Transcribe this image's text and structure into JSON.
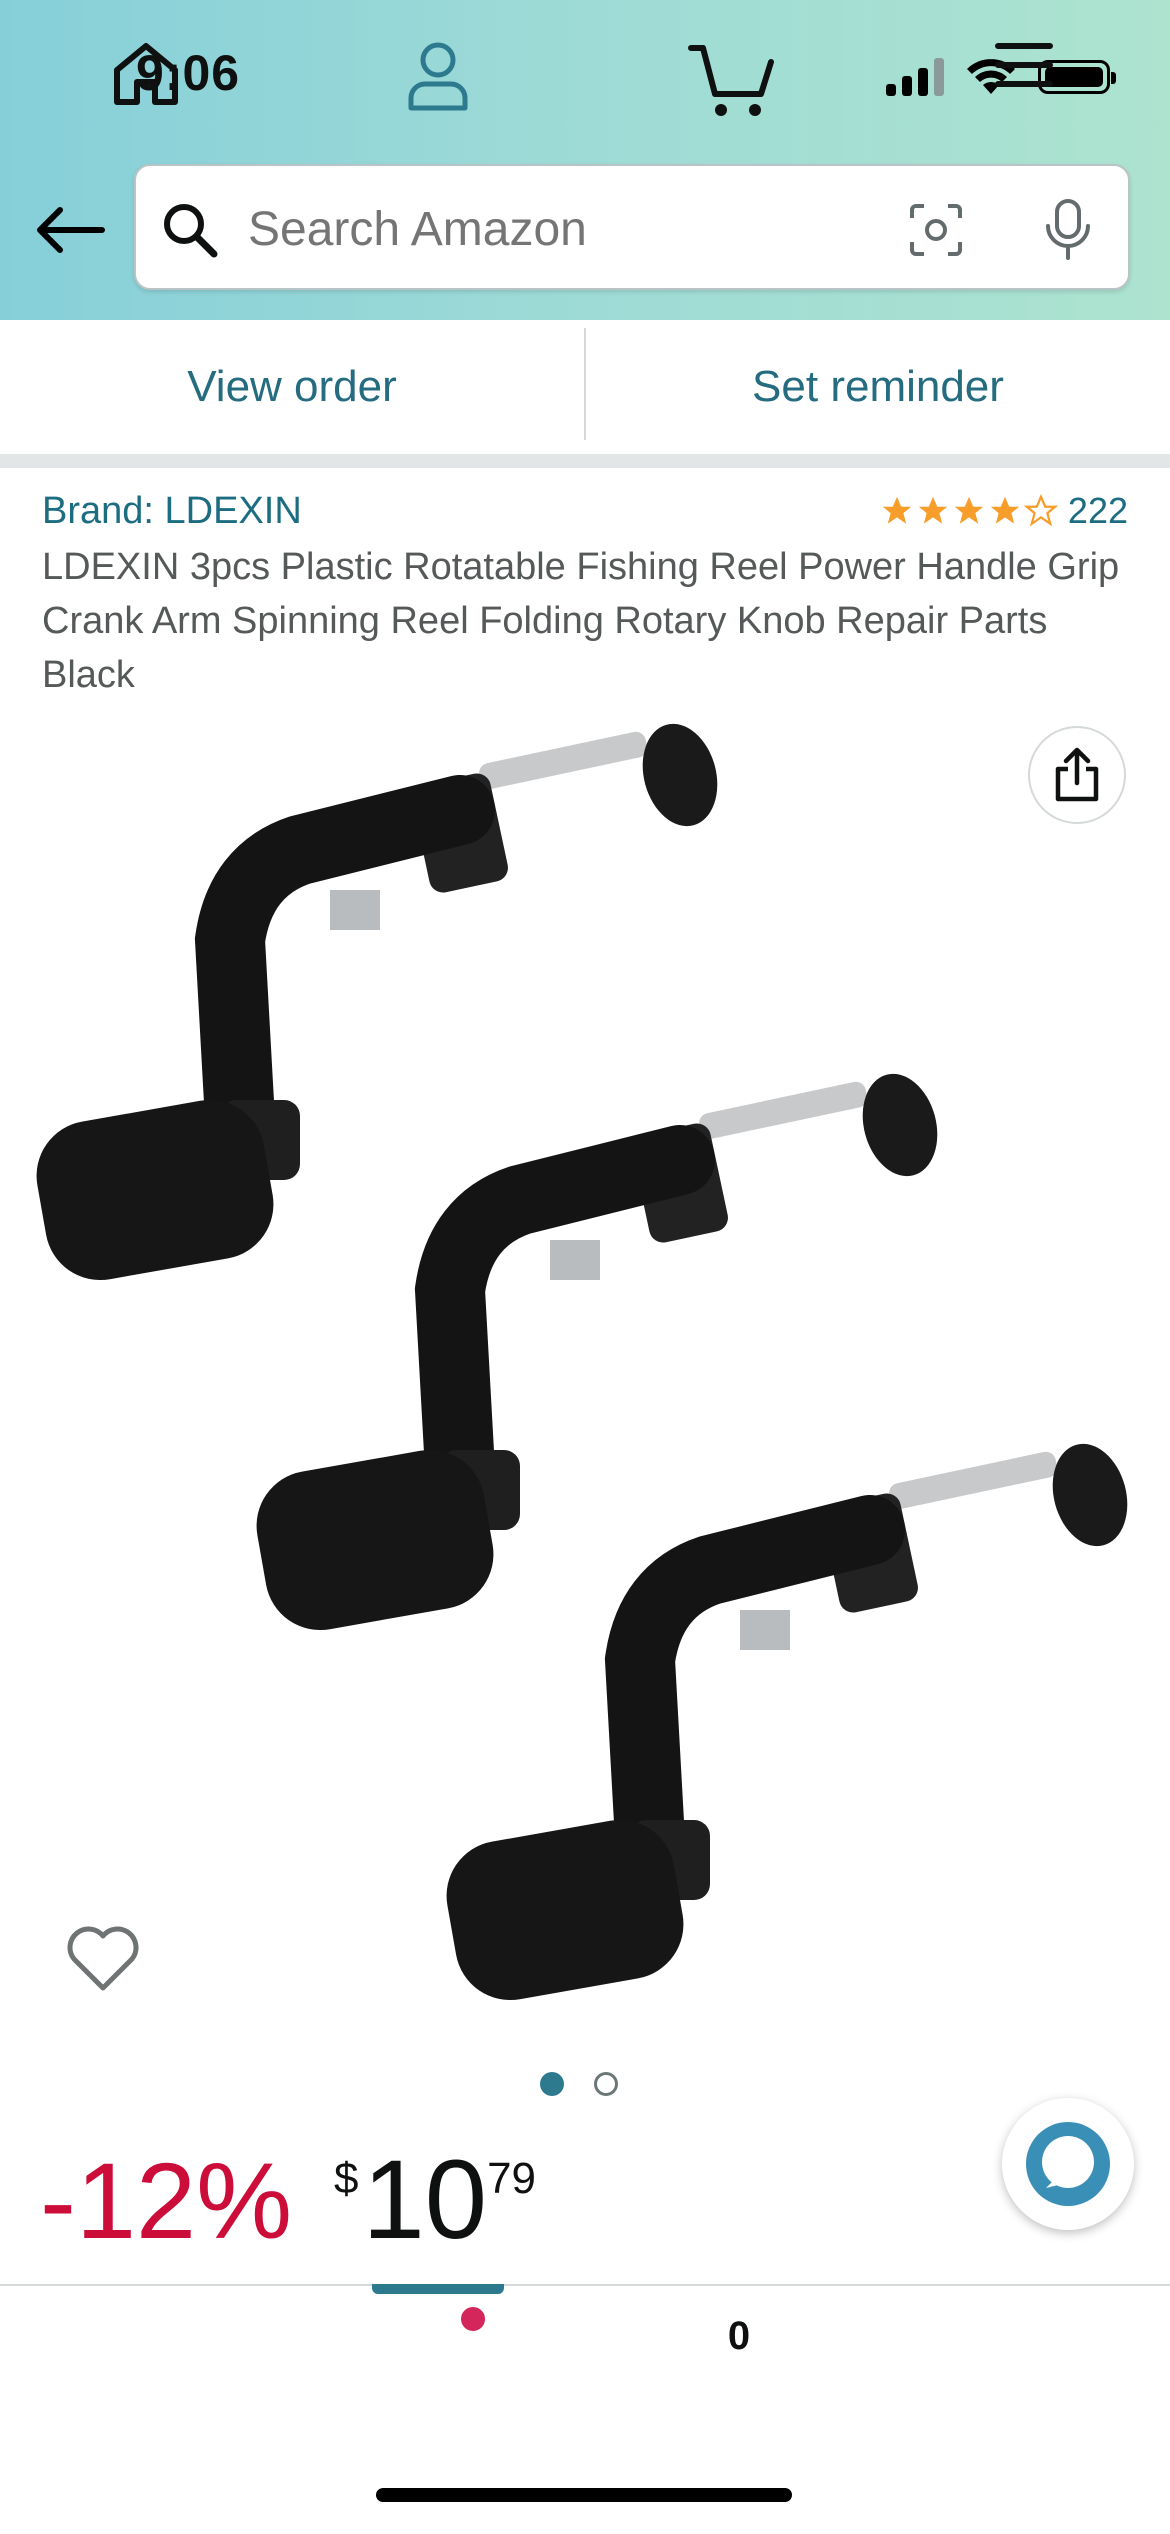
{
  "status_bar": {
    "time": "9:06"
  },
  "search": {
    "placeholder": "Search Amazon"
  },
  "order_bar": {
    "view_order": "View order",
    "set_reminder": "Set reminder"
  },
  "product": {
    "brand": "Brand: LDEXIN",
    "rating": 4.5,
    "rating_count": "222",
    "title": "LDEXIN 3pcs Plastic Rotatable Fishing Reel Power Handle Grip Crank Arm Spinning Reel Folding Rotary Knob Repair Parts Black",
    "image_count": 2,
    "active_image": 1
  },
  "price": {
    "discount": "-12%",
    "symbol": "$",
    "whole": "10",
    "fraction": "79"
  },
  "bottom_nav": {
    "items": [
      "home",
      "account",
      "cart",
      "menu"
    ],
    "active": "account",
    "cart_count": "0"
  },
  "colors": {
    "header_gradient_start": "#86cfd9",
    "header_gradient_end": "#ade3cf",
    "link": "#1d6d82",
    "discount": "#cc0c39",
    "star": "#f79d2a",
    "active_tab": "#2d7a8f",
    "badge": "#d4265b"
  }
}
